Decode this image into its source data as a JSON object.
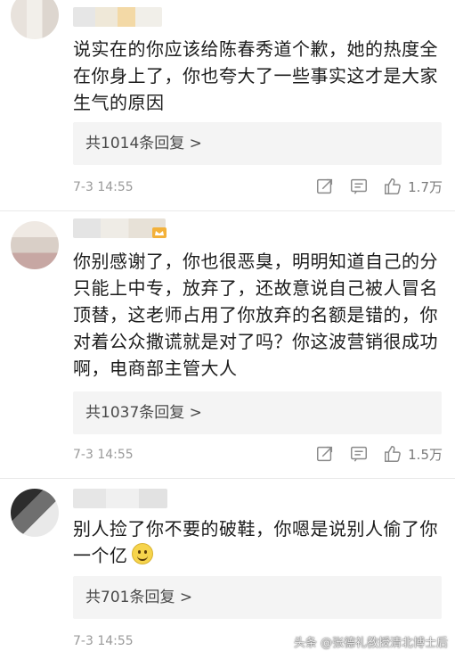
{
  "comments": [
    {
      "text": "说实在的你应该给陈春秀道个歉，她的热度全在你身上了，你也夸大了一些事实这才是大家生气的原因",
      "replies": "共1014条回复 >",
      "time": "7-3 14:55",
      "likes": "1.7万"
    },
    {
      "text": "你别感谢了，你也很恶臭，明明知道自己的分只能上中专，放弃了，还故意说自己被人冒名顶替，这老师占用了你放弃的名额是错的，你对着公众撒谎就是对了吗？你这波营销很成功啊，电商部主管大人",
      "replies": "共1037条回复 >",
      "time": "7-3 14:55",
      "likes": "1.5万"
    },
    {
      "text": "别人捡了你不要的破鞋，你嗯是说别人偷了你一个亿",
      "replies": "共701条回复 >",
      "time": "7-3 14:55",
      "likes": ""
    }
  ],
  "watermark": "头条 @张德礼教授清北博士后",
  "icons": [
    "share-icon",
    "comment-icon",
    "like-icon",
    "smile-emoji-icon"
  ]
}
